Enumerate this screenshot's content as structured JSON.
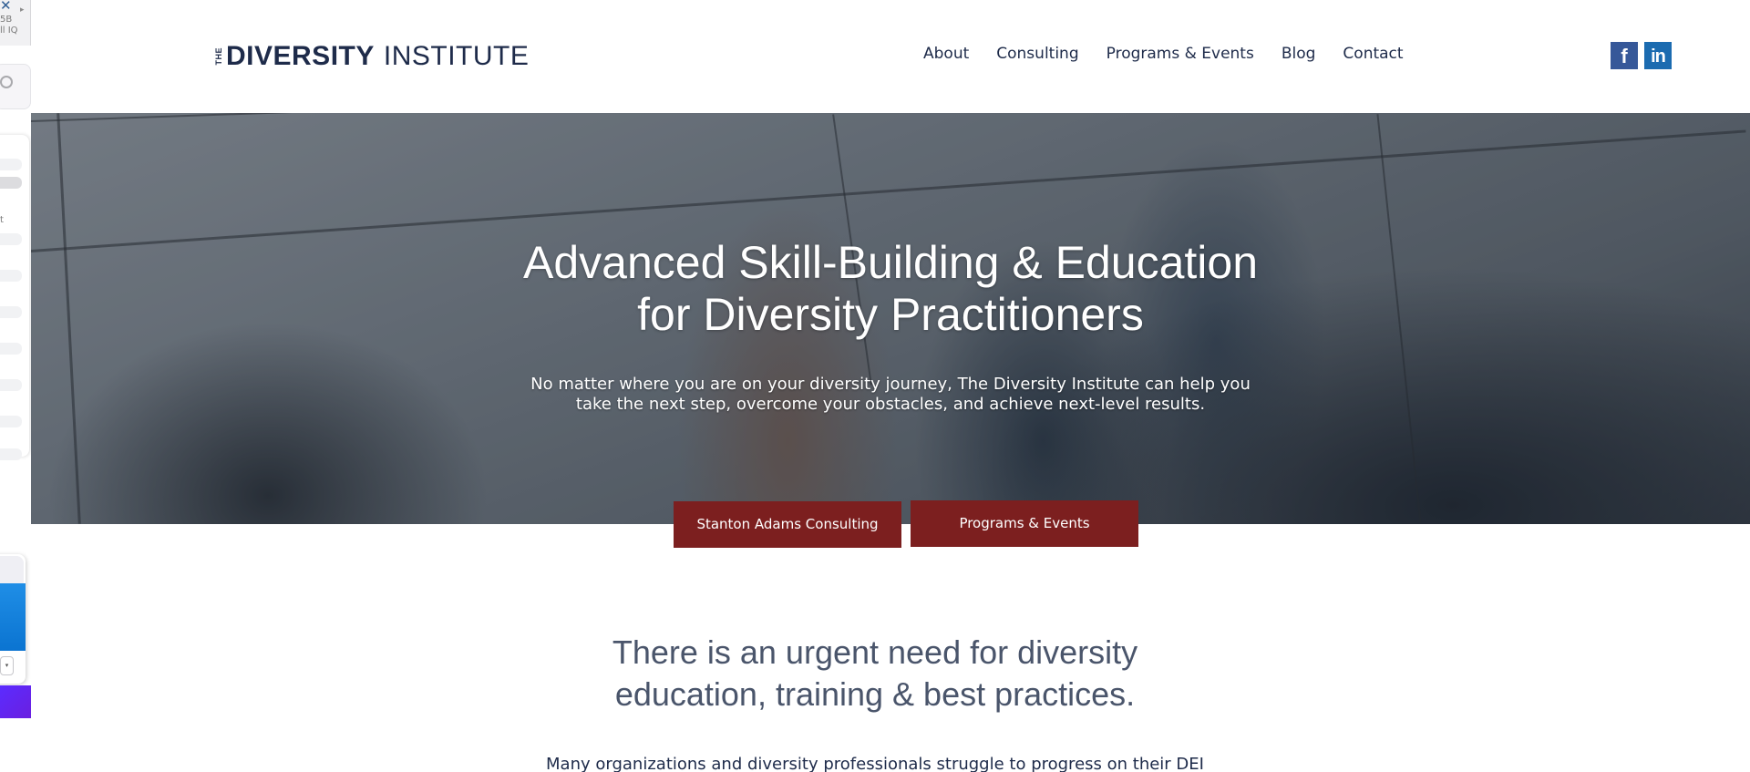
{
  "side_overlay": {
    "line1": "5B",
    "line2": "ll IQ",
    "line3": "t"
  },
  "header": {
    "logo": {
      "the": "THE",
      "diversity": "DIVERSITY",
      "institute": "INSTITUTE"
    },
    "nav": [
      {
        "label": "About"
      },
      {
        "label": "Consulting"
      },
      {
        "label": "Programs & Events"
      },
      {
        "label": "Blog"
      },
      {
        "label": "Contact"
      }
    ],
    "social": {
      "facebook": "f",
      "linkedin": "in"
    }
  },
  "hero": {
    "title_line1": "Advanced Skill-Building & Education",
    "title_line2": "for Diversity Practitioners",
    "subtitle_line1": "No matter where you are on your diversity journey, The Diversity Institute can help you",
    "subtitle_line2": "take the next step, overcome your obstacles, and achieve next-level results.",
    "buttons": [
      {
        "label": "Stanton Adams Consulting"
      },
      {
        "label": "Programs & Events"
      }
    ]
  },
  "intro": {
    "title_line1": "There is an urgent need for diversity",
    "title_line2": "education, training & best practices.",
    "body": "Many organizations and diversity professionals struggle to progress on their DEI"
  },
  "colors": {
    "brand_navy": "#1e2b4a",
    "button_red": "#7c1f1f",
    "facebook_blue": "#365899",
    "linkedin_blue": "#1b6bb0"
  }
}
